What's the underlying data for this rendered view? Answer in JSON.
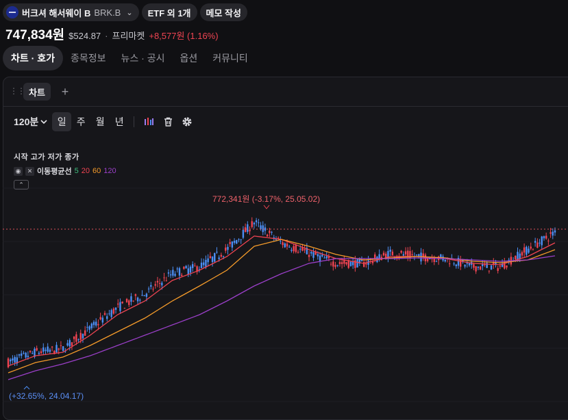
{
  "stock": {
    "name": "버크셔 해서웨이 B",
    "ticker": "BRK.B",
    "etf_badge": "ETF 외 1개",
    "memo_button": "메모 작성",
    "price_krw": "747,834원",
    "price_usd": "$524.87",
    "market_label": "프리마켓",
    "change": "+8,577원 (1.16%)"
  },
  "tabs": [
    "차트 · 호가",
    "종목정보",
    "뉴스 · 공시",
    "옵션",
    "커뮤니티"
  ],
  "active_tab": "차트 · 호가",
  "panel": {
    "chart_tab": "차트",
    "add_tab_symbol": "+"
  },
  "toolbar": {
    "period": "120분",
    "units": [
      "일",
      "주",
      "월",
      "년"
    ],
    "active_unit": "일",
    "icons": [
      "indicator-icon",
      "trash-icon",
      "settings-icon"
    ]
  },
  "legend": {
    "ohlc_labels": "시작 고가 저가 종가",
    "ma_title": "이동평균선",
    "ma_periods": [
      {
        "label": "5",
        "color": "#3fbf7f"
      },
      {
        "label": "20",
        "color": "#f04452"
      },
      {
        "label": "60",
        "color": "#f59b2a"
      },
      {
        "label": "120",
        "color": "#9b3fc9"
      }
    ]
  },
  "colors": {
    "up": "#f04452",
    "down": "#4c8ff5",
    "ma5": "#3fbf7f",
    "ma20": "#f04452",
    "ma60": "#f59b2a",
    "ma120": "#9b3fc9",
    "current_price_line": "#e0505a"
  },
  "annotations": {
    "high": "772,341원 (-3.17%, 25.05.02)",
    "low": "(+32.65%, 24.04.17)"
  },
  "chart_data": {
    "type": "candlestick",
    "x_range": [
      "24.04.17",
      "25.05"
    ],
    "series": [
      {
        "name": "5",
        "values": [
          560,
          575,
          580,
          610,
          640,
          660,
          690,
          700,
          725,
          765,
          735,
          720,
          705,
          705,
          720,
          715,
          712,
          700,
          700,
          725,
          750
        ]
      },
      {
        "name": "20",
        "values": [
          555,
          570,
          575,
          600,
          630,
          650,
          680,
          695,
          715,
          745,
          740,
          725,
          712,
          705,
          715,
          715,
          712,
          705,
          703,
          715,
          735
        ]
      },
      {
        "name": "60",
        "values": [
          545,
          560,
          568,
          585,
          605,
          625,
          650,
          672,
          695,
          730,
          740,
          730,
          718,
          710,
          713,
          715,
          713,
          708,
          706,
          710,
          725
        ]
      },
      {
        "name": "120",
        "values": [
          535,
          548,
          558,
          570,
          585,
          600,
          615,
          630,
          650,
          672,
          690,
          705,
          712,
          712,
          712,
          713,
          712,
          710,
          708,
          710,
          716
        ]
      }
    ]
  }
}
